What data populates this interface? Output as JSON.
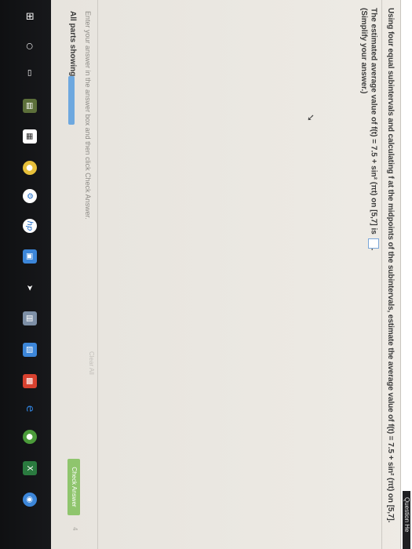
{
  "header": {
    "question_help_label": "Question He"
  },
  "question": {
    "text": "Using four equal subintervals and calculating f at the midpoints of the subintervals, estimate the average value of f(t) = 7.5 + sin² (πt) on [5,7].",
    "answer_prefix": "The estimated average value of f(t) = 7.5 + sin² (πt) on [5,7] is",
    "answer_value": "",
    "answer_suffix": ".",
    "simplify_note": "(Simplify your answer.)"
  },
  "footer": {
    "instruction": "Enter your answer in the answer box and then click Check Answer.",
    "clear_all_label": "Clear All",
    "all_parts_label": "All parts showing",
    "check_answer_label": "Check Answer",
    "step_number": "4"
  },
  "taskbar": {
    "icons": [
      "start-icon",
      "search-icon",
      "task-view-icon",
      "file-explorer-icon",
      "store-icon",
      "chrome-icon",
      "settings-icon",
      "hp-icon",
      "network-icon",
      "arrow-icon",
      "app-icon",
      "photos-icon",
      "office-icon",
      "edge-icon",
      "chrome-icon-2",
      "excel-icon"
    ]
  },
  "colors": {
    "accent_blue": "#6ea8df",
    "check_answer_green": "#8fc56d",
    "taskbar_bg": "#17181b"
  }
}
